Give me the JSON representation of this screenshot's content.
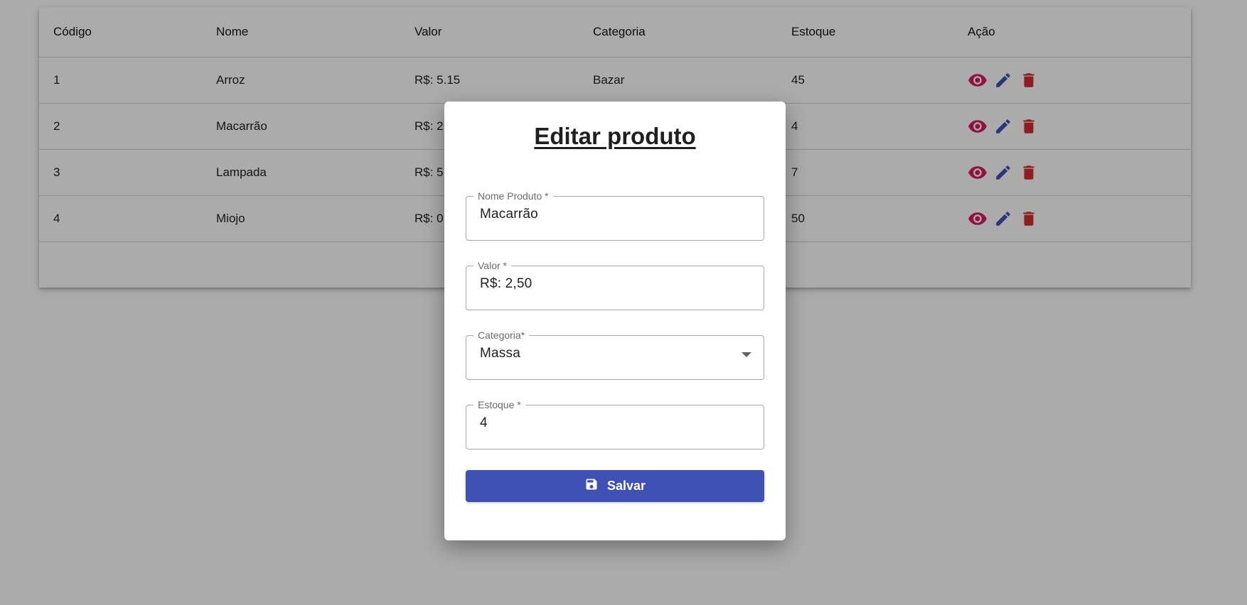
{
  "table": {
    "headers": [
      "Código",
      "Nome",
      "Valor",
      "Categoria",
      "Estoque",
      "Ação"
    ],
    "rows": [
      {
        "codigo": "1",
        "nome": "Arroz",
        "valor": "R$: 5.15",
        "categoria": "Bazar",
        "estoque": "45"
      },
      {
        "codigo": "2",
        "nome": "Macarrão",
        "valor": "R$: 2",
        "categoria": "",
        "estoque": "4"
      },
      {
        "codigo": "3",
        "nome": "Lampada",
        "valor": "R$: 5",
        "categoria": "",
        "estoque": "7"
      },
      {
        "codigo": "4",
        "nome": "Miojo",
        "valor": "R$: 0",
        "categoria": "",
        "estoque": "50"
      }
    ],
    "action_icons": [
      "eye-icon",
      "pencil-icon",
      "trash-icon"
    ]
  },
  "modal": {
    "title": "Editar produto",
    "fields": {
      "nome": {
        "label": "Nome Produto *",
        "value": "Macarrão"
      },
      "valor": {
        "label": "Valor *",
        "value": "R$: 2,50"
      },
      "categoria": {
        "label": "Categoria*",
        "value": "Massa"
      },
      "estoque": {
        "label": "Estoque *",
        "value": "4"
      }
    },
    "save_label": "Salvar",
    "save_icon": "floppy-disk-icon"
  },
  "colors": {
    "primary": "#3f51b5",
    "view": "#d81b60",
    "edit": "#3f51b5",
    "delete": "#d32f2f"
  }
}
